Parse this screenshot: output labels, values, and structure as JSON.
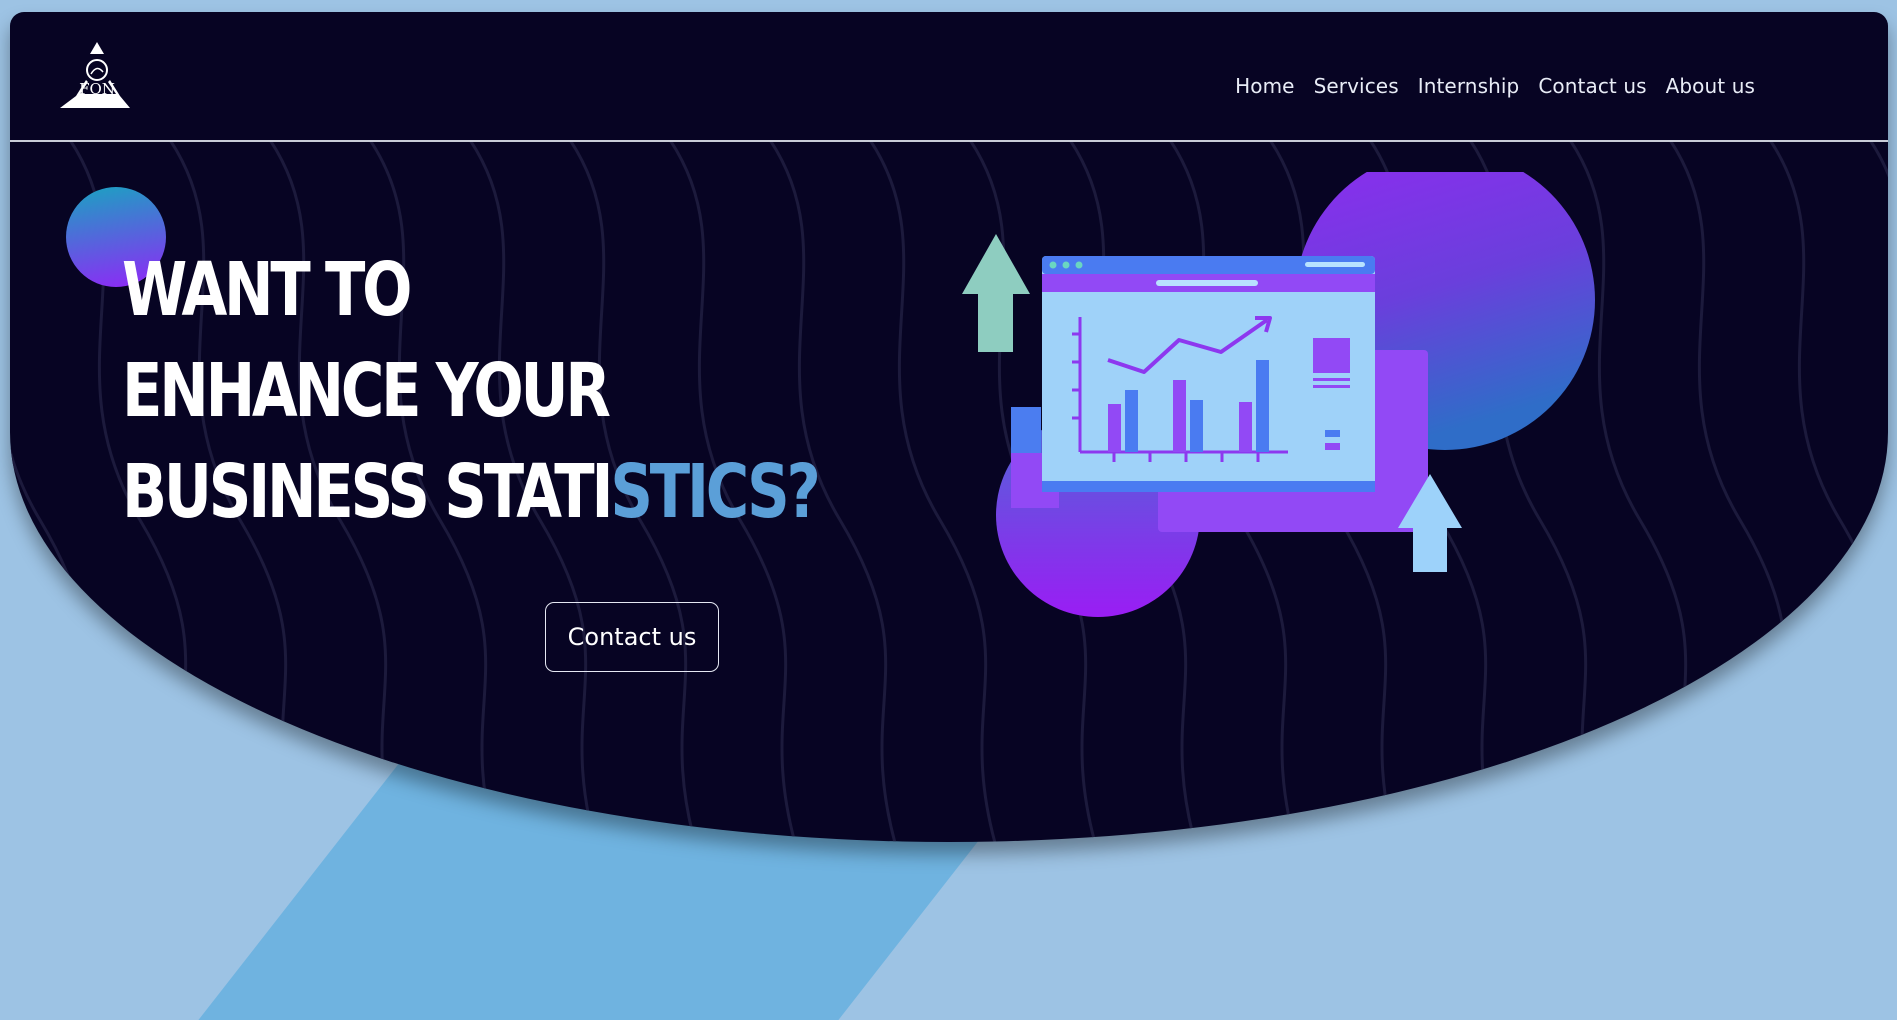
{
  "logo": {
    "text": "FON"
  },
  "nav": {
    "items": [
      "Home",
      "Services",
      "Internship",
      "Contact us",
      "About us"
    ]
  },
  "hero": {
    "headline_line1": "WANT TO",
    "headline_line2": "ENHANCE YOUR",
    "headline_line3_start": "BUSINESS STATI",
    "headline_line3_accent": "STICS?",
    "cta_label": "Contact us"
  },
  "illustration": {
    "icons": [
      "up-arrow-icon",
      "browser-window",
      "line-chart",
      "bar-chart",
      "up-arrow-icon"
    ]
  },
  "colors": {
    "page_background": "#9dc3e4",
    "hero_background": "#070423",
    "accent_text": "#5b9fd8",
    "purple": "#8b2cf5",
    "teal": "#1aa3c1"
  }
}
